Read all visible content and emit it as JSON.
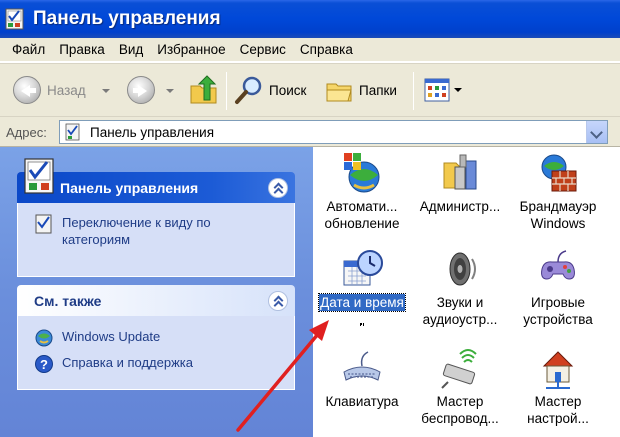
{
  "window": {
    "title": "Панель управления",
    "icon": "control-panel-icon"
  },
  "menu": [
    "Файл",
    "Правка",
    "Вид",
    "Избранное",
    "Сервис",
    "Справка"
  ],
  "toolbar": {
    "back_label": "Назад",
    "search_label": "Поиск",
    "folders_label": "Папки"
  },
  "address": {
    "label": "Адрес:",
    "value": "Панель управления"
  },
  "left_pane": {
    "panel1": {
      "title": "Панель управления",
      "links": [
        {
          "line1": "Переключение к виду по",
          "line2": "категориям",
          "icon": "category-view-icon"
        }
      ]
    },
    "panel2": {
      "title": "См. также",
      "links": [
        {
          "label": "Windows Update",
          "icon": "windows-update-icon"
        },
        {
          "label": "Справка и поддержка",
          "icon": "help-icon"
        }
      ]
    }
  },
  "items": [
    {
      "line1": "Автомати...",
      "line2": "обновление",
      "icon": "automatic-updates-icon"
    },
    {
      "line1": "Администр...",
      "line2": "",
      "icon": "administrative-tools-icon"
    },
    {
      "line1": "Брандмауэр",
      "line2": "Windows",
      "icon": "firewall-icon"
    },
    {
      "line1": "Дата и время",
      "line2": "",
      "icon": "date-time-icon",
      "selected": true
    },
    {
      "line1": "Звуки и",
      "line2": "аудиоустр...",
      "icon": "sounds-icon"
    },
    {
      "line1": "Игровые",
      "line2": "устройства",
      "icon": "game-controllers-icon"
    },
    {
      "line1": "Клавиатура",
      "line2": "",
      "icon": "keyboard-icon"
    },
    {
      "line1": "Мастер",
      "line2": "беспровод...",
      "icon": "wireless-wizard-icon"
    },
    {
      "line1": "Мастер",
      "line2": "настрой...",
      "icon": "network-wizard-icon"
    }
  ],
  "colors": {
    "titlebar": "#0048d8",
    "selection": "#316ac5",
    "arrow": "#e02020"
  }
}
